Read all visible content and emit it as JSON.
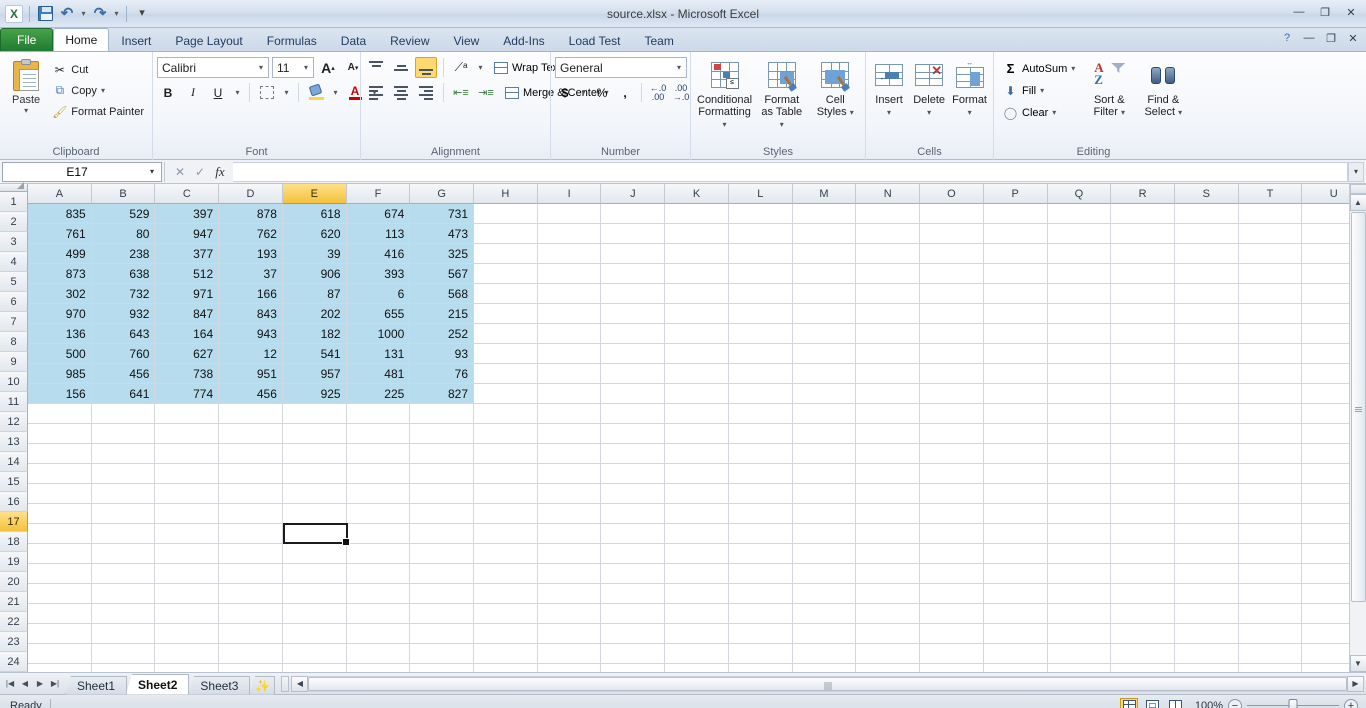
{
  "window": {
    "title": "source.xlsx  -  Microsoft Excel",
    "minimize": "—",
    "restore": "❐",
    "close": "✕",
    "help": "?",
    "ribbon_minimize": "—",
    "ribbon_restore": "❐",
    "ribbon_close": "✕"
  },
  "quick_access": {
    "logo": "X",
    "save": "save-icon",
    "undo": "↶",
    "undo_caret": "▾",
    "redo": "↷",
    "redo_caret": "▾",
    "customize": "▾"
  },
  "tabs": [
    {
      "label": "File",
      "active": false
    },
    {
      "label": "Home",
      "active": true
    },
    {
      "label": "Insert",
      "active": false
    },
    {
      "label": "Page Layout",
      "active": false
    },
    {
      "label": "Formulas",
      "active": false
    },
    {
      "label": "Data",
      "active": false
    },
    {
      "label": "Review",
      "active": false
    },
    {
      "label": "View",
      "active": false
    },
    {
      "label": "Add-Ins",
      "active": false
    },
    {
      "label": "Load Test",
      "active": false
    },
    {
      "label": "Team",
      "active": false
    }
  ],
  "ribbon": {
    "clipboard": {
      "label": "Clipboard",
      "paste": "Paste",
      "paste_caret": "▾",
      "cut": "Cut",
      "copy": "Copy",
      "copy_caret": "▾",
      "format_painter": "Format Painter",
      "launcher": "◪"
    },
    "font": {
      "label": "Font",
      "font_name": "Calibri",
      "font_size": "11",
      "grow_font": "A",
      "shrink_font": "A",
      "bold": "B",
      "italic": "I",
      "underline": "U",
      "underline_caret": "▾",
      "borders_caret": "▾",
      "fill_caret": "▾",
      "fontcolor_letter": "A",
      "fontcolor_caret": "▾",
      "launcher": "◪"
    },
    "alignment": {
      "label": "Alignment",
      "orientation_caret": "▾",
      "wrap_text": "Wrap Text",
      "merge_center": "Merge & Center",
      "merge_caret": "▾",
      "launcher": "◪"
    },
    "number": {
      "label": "Number",
      "format": "General",
      "format_caret": "▾",
      "currency": "$",
      "currency_caret": "▾",
      "percent": "%",
      "comma": ",",
      "increase_decimal": "＊.0",
      "decrease_decimal": ".00",
      "launcher": "◪"
    },
    "styles": {
      "label": "Styles",
      "conditional_formatting": "Conditional\nFormatting",
      "conditional_formatting_l1": "Conditional",
      "conditional_formatting_l2": "Formatting",
      "format_as_table_l1": "Format",
      "format_as_table_l2": "as Table",
      "cell_styles_l1": "Cell",
      "cell_styles_l2": "Styles",
      "caret": "▾"
    },
    "cells": {
      "label": "Cells",
      "insert": "Insert",
      "delete": "Delete",
      "format": "Format",
      "caret": "▾"
    },
    "editing": {
      "label": "Editing",
      "autosum": "AutoSum",
      "autosum_sigma": "Σ",
      "autosum_caret": "▾",
      "fill": "Fill",
      "fill_caret": "▾",
      "clear": "Clear",
      "clear_caret": "▾",
      "sort_filter_l1": "Sort &",
      "sort_filter_l2": "Filter",
      "find_select_l1": "Find &",
      "find_select_l2": "Select",
      "caret": "▾"
    }
  },
  "formula_bar": {
    "name_box": "E17",
    "name_box_caret": "▾",
    "cancel": "✕",
    "enter": "✓",
    "insert_function": "fx",
    "formula_value": "",
    "expand_caret": "▾"
  },
  "grid": {
    "columns": [
      "A",
      "B",
      "C",
      "D",
      "E",
      "F",
      "G",
      "H",
      "I",
      "J",
      "K",
      "L",
      "M",
      "N",
      "O",
      "P",
      "Q",
      "R",
      "S",
      "T",
      "U"
    ],
    "selected_column": "E",
    "rows": [
      1,
      2,
      3,
      4,
      5,
      6,
      7,
      8,
      9,
      10,
      11,
      12,
      13,
      14,
      15,
      16,
      17,
      18,
      19,
      20,
      21,
      22,
      23,
      24
    ],
    "selected_row": 17,
    "active_cell": "E17",
    "highlight_color": "#b7dced",
    "header_selected_color": "#f5c13c",
    "data_columns": [
      "A",
      "B",
      "C",
      "D",
      "E",
      "F",
      "G"
    ],
    "data": [
      [
        835,
        529,
        397,
        878,
        618,
        674,
        731
      ],
      [
        761,
        80,
        947,
        762,
        620,
        113,
        473
      ],
      [
        499,
        238,
        377,
        193,
        39,
        416,
        325
      ],
      [
        873,
        638,
        512,
        37,
        906,
        393,
        567
      ],
      [
        302,
        732,
        971,
        166,
        87,
        6,
        568
      ],
      [
        970,
        932,
        847,
        843,
        202,
        655,
        215
      ],
      [
        136,
        643,
        164,
        943,
        182,
        1000,
        252
      ],
      [
        500,
        760,
        627,
        12,
        541,
        131,
        93
      ],
      [
        985,
        456,
        738,
        951,
        957,
        481,
        76
      ],
      [
        156,
        641,
        774,
        456,
        925,
        225,
        827
      ]
    ]
  },
  "scrollbars": {
    "up": "▲",
    "down": "▼",
    "left": "◀",
    "right": "▶"
  },
  "sheet_tabs": {
    "first": "|◀",
    "prev": "◀",
    "next": "▶",
    "last": "▶|",
    "sheets": [
      {
        "label": "Sheet1",
        "active": false
      },
      {
        "label": "Sheet2",
        "active": true
      },
      {
        "label": "Sheet3",
        "active": false
      }
    ],
    "new_sheet": "✨"
  },
  "status_bar": {
    "mode": "Ready",
    "view_normal": "normal-view-icon",
    "view_page_layout": "page-layout-view-icon",
    "view_page_break": "page-break-view-icon",
    "zoom_level": "100%",
    "zoom_out": "−",
    "zoom_in": "+"
  }
}
